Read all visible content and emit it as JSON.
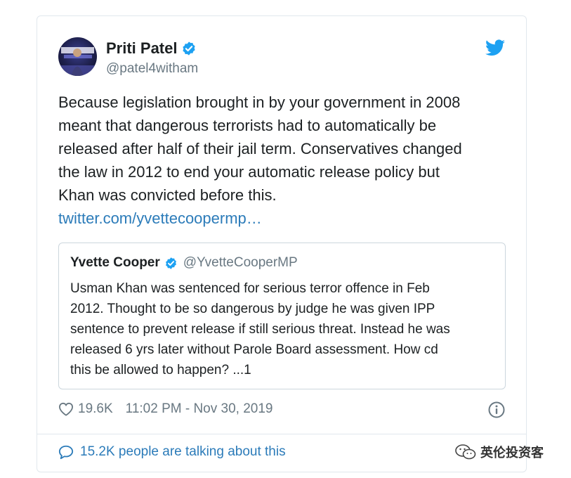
{
  "tweet": {
    "author": {
      "display_name": "Priti Patel",
      "handle": "@patel4witham",
      "verified": true
    },
    "text_lines": [
      "Because legislation brought in by your government in 2008",
      "meant that dangerous terrorists had to automatically be",
      "released after half of their jail term. Conservatives changed",
      "the law in 2012 to end your automatic release policy but",
      "Khan was convicted before this."
    ],
    "link_text": "twitter.com/yvettecoopermp…",
    "quoted": {
      "display_name": "Yvette Cooper",
      "handle": "@YvetteCooperMP",
      "verified": true,
      "text_lines": [
        "Usman Khan was sentenced for serious terror offence in Feb",
        "2012. Thought to be so dangerous by judge he was given IPP",
        "sentence to prevent release if still serious threat. Instead he was",
        "released 6 yrs later without Parole Board assessment. How cd",
        "this be allowed to happen? ...1"
      ]
    },
    "likes": "19.6K",
    "timestamp": "11:02 PM - Nov 30, 2019",
    "talking": "15.2K people are talking about this"
  },
  "icons": {
    "verified": "verified-badge-icon",
    "brand": "twitter-bird-icon",
    "like": "heart-icon",
    "info": "info-icon",
    "reply": "speech-bubble-icon",
    "watermark": "wechat-icon"
  },
  "watermark": {
    "text": "英伦投资客"
  },
  "colors": {
    "link": "#2b7bb9",
    "verified": "#1da1f2",
    "secondary_text": "#697882",
    "border": "#e1e8ed"
  }
}
